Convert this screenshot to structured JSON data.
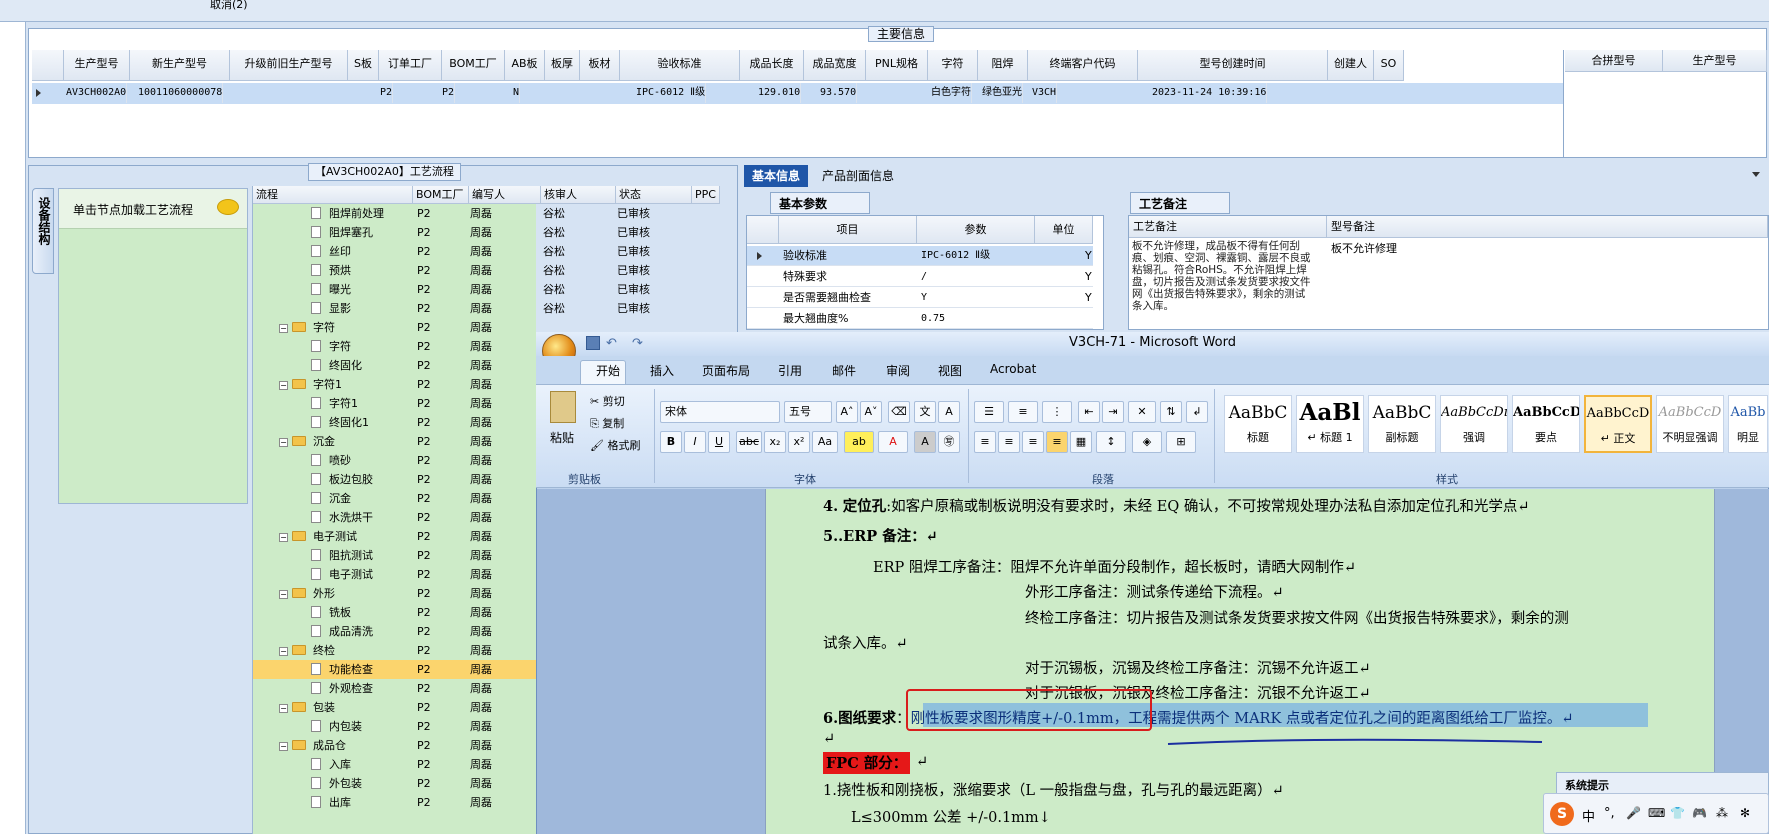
{
  "top": {
    "cancel_label": "取消(2)"
  },
  "main_info": {
    "title": "主要信息",
    "columns": [
      "生产型号",
      "新生产型号",
      "升级前旧生产型号",
      "S板",
      "订单工厂",
      "BOM工厂",
      "AB板",
      "板厚",
      "板材",
      "验收标准",
      "成品长度",
      "成品宽度",
      "PNL规格",
      "字符",
      "阻焊",
      "终端客户代码",
      "型号创建时间",
      "创建人",
      "SO"
    ],
    "row": {
      "prod_no": "AV3CH002A0",
      "new_prod_no": "10011060000078",
      "order_factory": "P2",
      "bom_factory": "P2",
      "ab": "N",
      "standard": "IPC-6012 Ⅱ级",
      "length": "129.010",
      "width": "93.570",
      "char": "白色字符",
      "mask": "绿色亚光",
      "customer": "V3CH",
      "created": "2023-11-24 10:39:16"
    },
    "side_columns": [
      "合拼型号",
      "生产型号"
    ]
  },
  "process": {
    "title": "【AV3CH002A0】工艺流程",
    "vtab_label": "设备结构",
    "click_hint": "单击节点加载工艺流程",
    "columns": [
      "流程",
      "BOM工厂",
      "编写人",
      "核审人",
      "状态",
      "PPC"
    ],
    "rows": [
      {
        "name": "阻焊前处理",
        "type": "doc",
        "factory": "P2",
        "writer": "周磊",
        "reviewer": "谷松",
        "status": "已审核"
      },
      {
        "name": "阻焊塞孔",
        "type": "doc",
        "factory": "P2",
        "writer": "周磊",
        "reviewer": "谷松",
        "status": "已审核"
      },
      {
        "name": "丝印",
        "type": "doc",
        "factory": "P2",
        "writer": "周磊",
        "reviewer": "谷松",
        "status": "已审核"
      },
      {
        "name": "预烘",
        "type": "doc",
        "factory": "P2",
        "writer": "周磊",
        "reviewer": "谷松",
        "status": "已审核"
      },
      {
        "name": "曝光",
        "type": "doc",
        "factory": "P2",
        "writer": "周磊",
        "reviewer": "谷松",
        "status": "已审核"
      },
      {
        "name": "显影",
        "type": "doc",
        "factory": "P2",
        "writer": "周磊",
        "reviewer": "谷松",
        "status": "已审核"
      },
      {
        "name": "字符",
        "type": "folder",
        "factory": "P2",
        "writer": "周磊",
        "reviewer": "",
        "status": ""
      },
      {
        "name": "字符",
        "type": "doc",
        "factory": "P2",
        "writer": "周磊",
        "reviewer": "",
        "status": ""
      },
      {
        "name": "终固化",
        "type": "doc",
        "factory": "P2",
        "writer": "周磊",
        "reviewer": "",
        "status": ""
      },
      {
        "name": "字符1",
        "type": "folder",
        "factory": "P2",
        "writer": "周磊",
        "reviewer": "",
        "status": ""
      },
      {
        "name": "字符1",
        "type": "doc",
        "factory": "P2",
        "writer": "周磊",
        "reviewer": "",
        "status": ""
      },
      {
        "name": "终固化1",
        "type": "doc",
        "factory": "P2",
        "writer": "周磊",
        "reviewer": "",
        "status": ""
      },
      {
        "name": "沉金",
        "type": "folder",
        "factory": "P2",
        "writer": "周磊",
        "reviewer": "",
        "status": ""
      },
      {
        "name": "喷砂",
        "type": "doc",
        "factory": "P2",
        "writer": "周磊",
        "reviewer": "",
        "status": ""
      },
      {
        "name": "板边包胶",
        "type": "doc",
        "factory": "P2",
        "writer": "周磊",
        "reviewer": "",
        "status": ""
      },
      {
        "name": "沉金",
        "type": "doc",
        "factory": "P2",
        "writer": "周磊",
        "reviewer": "",
        "status": ""
      },
      {
        "name": "水洗烘干",
        "type": "doc",
        "factory": "P2",
        "writer": "周磊",
        "reviewer": "",
        "status": ""
      },
      {
        "name": "电子测试",
        "type": "folder",
        "factory": "P2",
        "writer": "周磊",
        "reviewer": "",
        "status": ""
      },
      {
        "name": "阻抗测试",
        "type": "doc",
        "factory": "P2",
        "writer": "周磊",
        "reviewer": "",
        "status": ""
      },
      {
        "name": "电子测试",
        "type": "doc",
        "factory": "P2",
        "writer": "周磊",
        "reviewer": "",
        "status": ""
      },
      {
        "name": "外形",
        "type": "folder",
        "factory": "P2",
        "writer": "周磊",
        "reviewer": "",
        "status": ""
      },
      {
        "name": "铣板",
        "type": "doc",
        "factory": "P2",
        "writer": "周磊",
        "reviewer": "",
        "status": ""
      },
      {
        "name": "成品清洗",
        "type": "doc",
        "factory": "P2",
        "writer": "周磊",
        "reviewer": "",
        "status": ""
      },
      {
        "name": "终检",
        "type": "folder",
        "factory": "P2",
        "writer": "周磊",
        "reviewer": "",
        "status": ""
      },
      {
        "name": "功能检查",
        "type": "doc",
        "factory": "P2",
        "writer": "周磊",
        "reviewer": "",
        "status": "",
        "selected": true
      },
      {
        "name": "外观检查",
        "type": "doc",
        "factory": "P2",
        "writer": "周磊",
        "reviewer": "",
        "status": ""
      },
      {
        "name": "包装",
        "type": "folder",
        "factory": "P2",
        "writer": "周磊",
        "reviewer": "",
        "status": ""
      },
      {
        "name": "内包装",
        "type": "doc",
        "factory": "P2",
        "writer": "周磊",
        "reviewer": "",
        "status": ""
      },
      {
        "name": "成品仓",
        "type": "folder",
        "factory": "P2",
        "writer": "周磊",
        "reviewer": "",
        "status": ""
      },
      {
        "name": "入库",
        "type": "doc",
        "factory": "P2",
        "writer": "周磊",
        "reviewer": "",
        "status": ""
      },
      {
        "name": "外包装",
        "type": "doc",
        "factory": "P2",
        "writer": "周磊",
        "reviewer": "",
        "status": ""
      },
      {
        "name": "出库",
        "type": "doc",
        "factory": "P2",
        "writer": "周磊",
        "reviewer": "",
        "status": ""
      }
    ]
  },
  "right": {
    "tab_basic": "基本信息",
    "tab_profile": "产品剖面信息",
    "basic_params_title": "基本参数",
    "basic_cols": [
      "项目",
      "参数",
      "单位"
    ],
    "basic_rows": [
      {
        "item": "验收标准",
        "param": "IPC-6012 Ⅱ级",
        "unit": "",
        "flag": "Y"
      },
      {
        "item": "特殊要求",
        "param": "/",
        "unit": "",
        "flag": "Y"
      },
      {
        "item": "是否需要翘曲检查",
        "param": "Y",
        "unit": "",
        "flag": "Y"
      },
      {
        "item": "最大翘曲度%",
        "param": "0.75",
        "unit": "",
        "flag": ""
      }
    ],
    "process_note_title": "工艺备注",
    "note_cols": [
      "工艺备注",
      "型号备注"
    ],
    "process_note": "板不允许修理，成品板不得有任何刮痕、划痕、空洞、裸露铜、露层不良或粘锡孔。符合RoHS。不允许阻焊上焊盘，切片报告及测试条发货要求按文件网《出货报告特殊要求》，剩余的测试条入库。",
    "model_note": "板不允许修理"
  },
  "word": {
    "title": "V3CH-71 - Microsoft Word",
    "tabs": [
      "开始",
      "插入",
      "页面布局",
      "引用",
      "邮件",
      "审阅",
      "视图",
      "Acrobat"
    ],
    "clipboard": {
      "paste": "粘贴",
      "cut": "剪切",
      "copy": "复制",
      "format": "格式刷",
      "group": "剪贴板"
    },
    "font": {
      "name": "宋体",
      "size": "五号",
      "group": "字体"
    },
    "paragraph_group": "段落",
    "styles_group": "样式",
    "styles": [
      {
        "sample": "AaBbC",
        "label": "标题"
      },
      {
        "sample": "AaBl",
        "label": "↵ 标题 1"
      },
      {
        "sample": "AaBbC",
        "label": "副标题"
      },
      {
        "sample": "AaBbCcDı",
        "label": "强调"
      },
      {
        "sample": "AaBbCcD",
        "label": "要点"
      },
      {
        "sample": "AaBbCcD",
        "label": "↵ 正文"
      },
      {
        "sample": "AaBbCcD",
        "label": "不明显强调"
      },
      {
        "sample": "AaBb",
        "label": "明显"
      }
    ],
    "doc": {
      "l1_num": "4.",
      "l1_bold": "定位孔",
      "l1_rest": ":如客户原稿或制板说明没有要求时，未经 EQ 确认，不可按常规处理办法私自添加定位孔和光学点↵",
      "l2": "5..ERP 备注：↵",
      "l3": "ERP 阻焊工序备注：阻焊不允许单面分段制作，超长板时，请晒大网制作↵",
      "l4": "外形工序备注：测试条传递给下流程。↵",
      "l5": "终检工序备注：切片报告及测试条发货要求按文件网《出货报告特殊要求》，剩余的测",
      "l6": "试条入库。↵",
      "l7": "对于沉锡板，沉锡及终检工序备注：沉锡不允许返工↵",
      "l8": "对于沉银板，沉银及终检工序备注：沉银不允许返工↵",
      "l9_bold": "6.图纸要求",
      "l9_colon": "：",
      "l9_rest": "刚性板要求图形精度+/-0.1mm，工程需提供两个 MARK 点或者定位孔之间的距离图纸给工厂监控。↵",
      "l10": "↵",
      "l11": "FPC 部分：",
      "l11_tail": "↵",
      "l12": "1.挠性板和刚挠板，涨缩要求（L 一般指盘与盘，孔与孔的最远距离）↵",
      "l13": "L≤300mm 公差 +/-0.1mm↓"
    }
  },
  "system_prompt": {
    "title": "系统提示"
  },
  "ime": {
    "items": [
      "中",
      "°,",
      "🎤",
      "⌨",
      "👕",
      "🎮",
      "⁂",
      "✻"
    ]
  }
}
